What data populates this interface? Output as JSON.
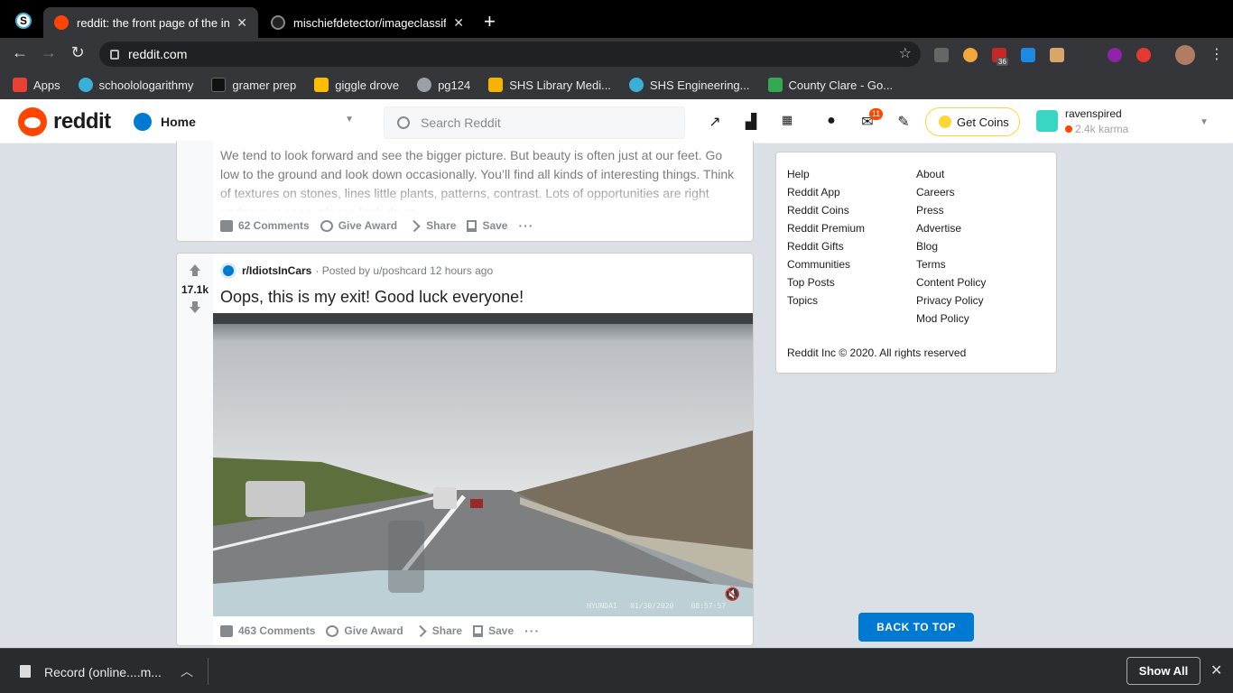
{
  "browser": {
    "tabs": [
      {
        "title": "reddit: the front page of the int",
        "favicon": "reddit-icon",
        "active": true
      },
      {
        "title": "mischiefdetector/imageclassifi",
        "favicon": "github-icon",
        "active": false
      }
    ],
    "url": "reddit.com",
    "bookmarks": [
      {
        "label": "Apps",
        "icon": "apps-grid-icon",
        "color": "#e94235"
      },
      {
        "label": "schoolologarithmy",
        "icon": "schoology-icon",
        "color": "#3ab0d6"
      },
      {
        "label": "gramer prep",
        "icon": "gb-icon",
        "color": "#111111"
      },
      {
        "label": "giggle drove",
        "icon": "drive-icon",
        "color": "#fbbc04"
      },
      {
        "label": "pg124",
        "icon": "globe-icon",
        "color": "#9aa0a6"
      },
      {
        "label": "SHS Library Medi...",
        "icon": "library-icon",
        "color": "#f4b400"
      },
      {
        "label": "SHS Engineering...",
        "icon": "schoology-icon",
        "color": "#3ab0d6"
      },
      {
        "label": "County Clare - Go...",
        "icon": "maps-icon",
        "color": "#34a853"
      }
    ],
    "extension_badge": "36"
  },
  "reddit_header": {
    "wordmark": "reddit",
    "feed_selector": "Home",
    "search_placeholder": "Search Reddit",
    "notification_count": "11",
    "get_coins": "Get Coins",
    "username": "ravenspired",
    "karma": "2.4k karma"
  },
  "posts": [
    {
      "body_text": "We tend to look forward and see the bigger picture. But beauty is often just at our feet. Go low to the ground and look down occasionally. You’ll find all kinds of interesting things. Think of textures on stones, lines little plants, patterns, contrast. Lots of opportunities are right under your nose, please look down.",
      "comments": "62 Comments",
      "give_award": "Give Award",
      "share": "Share",
      "save": "Save"
    },
    {
      "votes": "17.1k",
      "subreddit": "r/IdiotsInCars",
      "posted_by": "· Posted by u/poshcard 12 hours ago",
      "title": "Oops, this is my exit! Good luck everyone!",
      "video_stamp": "HYUNDAI   01/30/2020    08:57:57",
      "comments": "463 Comments",
      "give_award": "Give Award",
      "share": "Share",
      "save": "Save"
    }
  ],
  "footer": {
    "left_links": [
      "Help",
      "Reddit App",
      "Reddit Coins",
      "Reddit Premium",
      "Reddit Gifts",
      "Communities",
      "Top Posts",
      "Topics"
    ],
    "right_links": [
      "About",
      "Careers",
      "Press",
      "Advertise",
      "Blog",
      "Terms",
      "Content Policy",
      "Privacy Policy",
      "Mod Policy"
    ],
    "copyright": "Reddit Inc © 2020. All rights reserved",
    "back_to_top": "BACK TO TOP"
  },
  "download_bar": {
    "file_name": "Record (online....m...",
    "show_all": "Show All"
  },
  "colors": {
    "reddit_orange": "#ff4500",
    "reddit_blue": "#0079d3",
    "page_bg": "#dae0e6",
    "coin_gold": "#ffd635"
  }
}
